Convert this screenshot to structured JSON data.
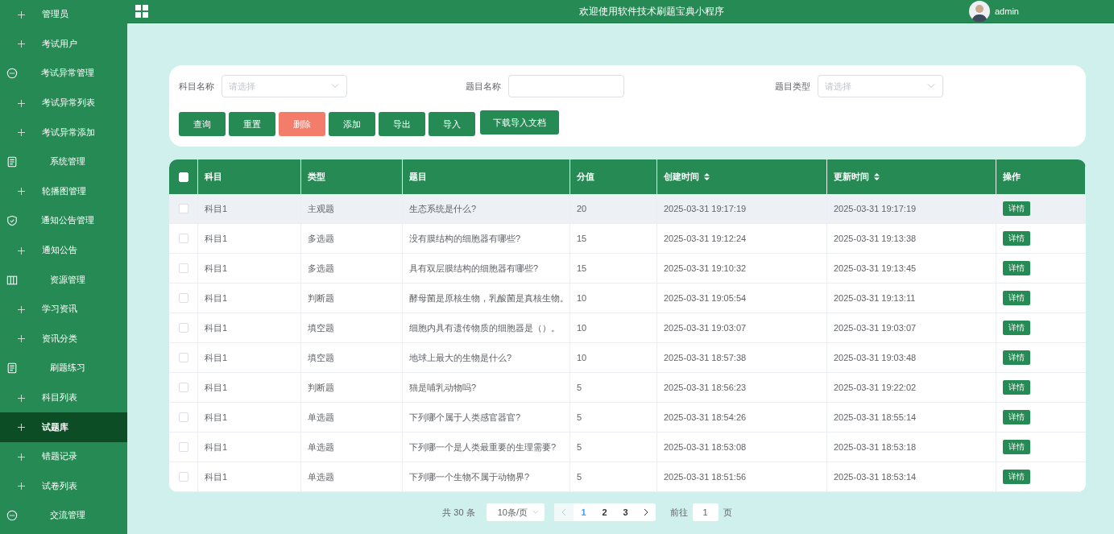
{
  "sidebar": {
    "items": [
      {
        "kind": "sub",
        "label": "管理员",
        "selected": false
      },
      {
        "kind": "sub",
        "label": "考试用户",
        "selected": false
      },
      {
        "kind": "group",
        "label": "考试异常管理",
        "selected": false
      },
      {
        "kind": "sub",
        "label": "考试异常列表",
        "selected": false
      },
      {
        "kind": "sub",
        "label": "考试异常添加",
        "selected": false
      },
      {
        "kind": "group",
        "label": "系统管理",
        "selected": false
      },
      {
        "kind": "sub",
        "label": "轮播图管理",
        "selected": false
      },
      {
        "kind": "group",
        "label": "通知公告管理",
        "selected": false
      },
      {
        "kind": "sub",
        "label": "通知公告",
        "selected": false
      },
      {
        "kind": "group",
        "label": "资源管理",
        "selected": false
      },
      {
        "kind": "sub",
        "label": "学习资讯",
        "selected": false
      },
      {
        "kind": "sub",
        "label": "资讯分类",
        "selected": false
      },
      {
        "kind": "group",
        "label": "刷题练习",
        "selected": false
      },
      {
        "kind": "sub",
        "label": "科目列表",
        "selected": false
      },
      {
        "kind": "sub",
        "label": "试题库",
        "selected": true
      },
      {
        "kind": "sub",
        "label": "错题记录",
        "selected": false
      },
      {
        "kind": "sub",
        "label": "试卷列表",
        "selected": false
      },
      {
        "kind": "group",
        "label": "交流管理",
        "selected": false
      }
    ]
  },
  "header": {
    "title": "欢迎使用软件技术刷题宝典小程序",
    "user": "admin"
  },
  "filters": [
    {
      "kind": "select",
      "label": "科目名称",
      "placeholder": "请选择"
    },
    {
      "kind": "input",
      "label": "题目名称"
    },
    {
      "kind": "select",
      "label": "题目类型",
      "placeholder": "请选择"
    }
  ],
  "buttons": [
    {
      "label": "查询",
      "kind": "primary"
    },
    {
      "label": "重置",
      "kind": "primary"
    },
    {
      "label": "删除",
      "kind": "danger"
    },
    {
      "label": "添加",
      "kind": "primary"
    },
    {
      "label": "导出",
      "kind": "primary"
    },
    {
      "label": "导入",
      "kind": "primary"
    },
    {
      "label": "下载导入文档",
      "kind": "primary"
    }
  ],
  "table": {
    "all_checked": false,
    "columns": [
      {
        "label": "科目",
        "sortable": false
      },
      {
        "label": "类型",
        "sortable": false
      },
      {
        "label": "题目",
        "sortable": false
      },
      {
        "label": "分值",
        "sortable": false
      },
      {
        "label": "创建时间",
        "sortable": true
      },
      {
        "label": "更新时间",
        "sortable": true
      },
      {
        "label": "操作",
        "sortable": false
      }
    ],
    "rows": [
      {
        "checked": false,
        "hovered": true,
        "cells": [
          "科目1",
          "主观题",
          "生态系统是什么?",
          "20",
          "2025-03-31 19:17:19",
          "2025-03-31 19:17:19"
        ],
        "action": "详情"
      },
      {
        "checked": false,
        "hovered": false,
        "cells": [
          "科目1",
          "多选题",
          "没有膜结构的细胞器有哪些?",
          "15",
          "2025-03-31 19:12:24",
          "2025-03-31 19:13:38"
        ],
        "action": "详情"
      },
      {
        "checked": false,
        "hovered": false,
        "cells": [
          "科目1",
          "多选题",
          "具有双层膜结构的细胞器有哪些?",
          "15",
          "2025-03-31 19:10:32",
          "2025-03-31 19:13:45"
        ],
        "action": "详情"
      },
      {
        "checked": false,
        "hovered": false,
        "cells": [
          "科目1",
          "判断题",
          "酵母菌是原核生物，乳酸菌是真核生物。",
          "10",
          "2025-03-31 19:05:54",
          "2025-03-31 19:13:11"
        ],
        "action": "详情"
      },
      {
        "checked": false,
        "hovered": false,
        "cells": [
          "科目1",
          "填空题",
          "细胞内具有遗传物质的细胞器是（）。",
          "10",
          "2025-03-31 19:03:07",
          "2025-03-31 19:03:07"
        ],
        "action": "详情"
      },
      {
        "checked": false,
        "hovered": false,
        "cells": [
          "科目1",
          "填空题",
          "地球上最大的生物是什么?",
          "10",
          "2025-03-31 18:57:38",
          "2025-03-31 19:03:48"
        ],
        "action": "详情"
      },
      {
        "checked": false,
        "hovered": false,
        "cells": [
          "科目1",
          "判断题",
          "猫是哺乳动物吗?",
          "5",
          "2025-03-31 18:56:23",
          "2025-03-31 19:22:02"
        ],
        "action": "详情"
      },
      {
        "checked": false,
        "hovered": false,
        "cells": [
          "科目1",
          "单选题",
          "下列哪个属于人类感官器官?",
          "5",
          "2025-03-31 18:54:26",
          "2025-03-31 18:55:14"
        ],
        "action": "详情"
      },
      {
        "checked": false,
        "hovered": false,
        "cells": [
          "科目1",
          "单选题",
          "下列哪一个是人类最重要的生理需要?",
          "5",
          "2025-03-31 18:53:08",
          "2025-03-31 18:53:18"
        ],
        "action": "详情"
      },
      {
        "checked": false,
        "hovered": false,
        "cells": [
          "科目1",
          "单选题",
          "下列哪一个生物不属于动物界?",
          "5",
          "2025-03-31 18:51:56",
          "2025-03-31 18:53:14"
        ],
        "action": "详情"
      }
    ]
  },
  "pagination": {
    "total": "共 30 条",
    "page_size": "10条/页",
    "pages": [
      {
        "label": "1",
        "selected": true
      },
      {
        "label": "2",
        "selected": false
      },
      {
        "label": "3",
        "selected": false
      }
    ],
    "goto_label": "前往",
    "goto_value": "1",
    "goto_suffix": "页"
  }
}
